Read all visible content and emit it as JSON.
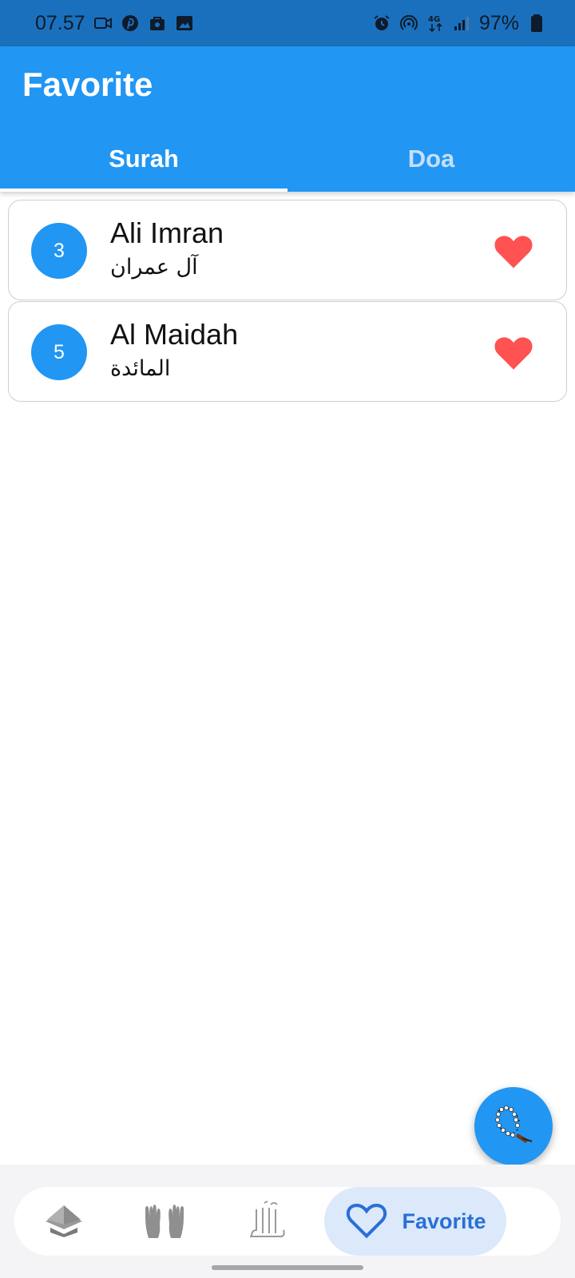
{
  "status_bar": {
    "time": "07.57",
    "battery": "97%",
    "network": "4G",
    "left_icons": [
      "video-icon",
      "pinterest-icon",
      "bag-icon",
      "image-icon"
    ],
    "right_icons": [
      "alarm-icon",
      "hotspot-icon",
      "network-4g-icon",
      "signal-icon",
      "battery-icon"
    ]
  },
  "app_bar": {
    "title": "Favorite"
  },
  "tabs": [
    {
      "label": "Surah",
      "active": true
    },
    {
      "label": "Doa",
      "active": false
    }
  ],
  "favorites": [
    {
      "number": "3",
      "name": "Ali Imran",
      "arabic": "آل عمران"
    },
    {
      "number": "5",
      "name": "Al Maidah",
      "arabic": "المائدة"
    }
  ],
  "bottom_nav": {
    "items": [
      {
        "icon": "quran-icon"
      },
      {
        "icon": "praying-hands-icon"
      },
      {
        "icon": "allah-calligraphy-icon"
      },
      {
        "icon": "heart-outline-icon",
        "label": "Favorite",
        "active": true
      }
    ]
  },
  "fab": {
    "icon": "prayer-beads-icon"
  },
  "colors": {
    "primary": "#2196f3",
    "status_bar": "#1b70bd",
    "heart": "#ff5252",
    "nav_active_bg": "#dbe9fb",
    "nav_active_text": "#2a6fd6"
  }
}
